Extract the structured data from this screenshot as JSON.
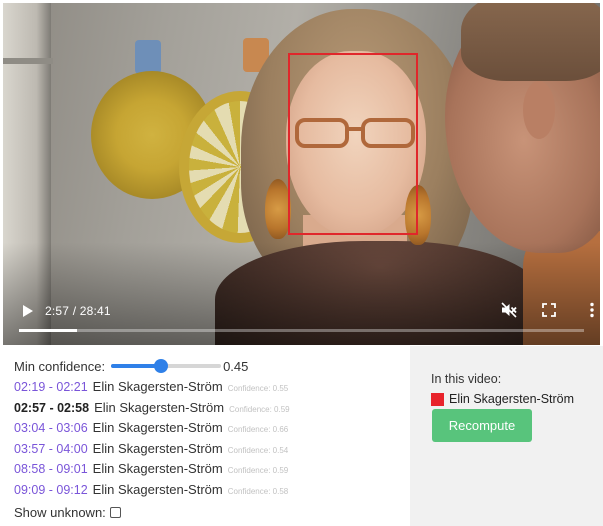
{
  "player": {
    "time_display": "2:57 / 28:41",
    "progress_fraction": 0.103,
    "icons": {
      "play": "play-icon",
      "mute": "volume-muted-icon",
      "fullscreen": "fullscreen-icon",
      "more": "more-vertical-icon"
    }
  },
  "face_box": {
    "color": "#e0272b"
  },
  "confidence": {
    "label": "Min confidence:",
    "value": "0.45",
    "fraction": 0.45
  },
  "occurrences": [
    {
      "time": "02:19 - 02:21",
      "name": "Elin Skagersten-Ström",
      "confidence": "Confidence: 0.55",
      "current": false
    },
    {
      "time": "02:57 - 02:58",
      "name": "Elin Skagersten-Ström",
      "confidence": "Confidence: 0.59",
      "current": true
    },
    {
      "time": "03:04 - 03:06",
      "name": "Elin Skagersten-Ström",
      "confidence": "Confidence: 0.66",
      "current": false
    },
    {
      "time": "03:57 - 04:00",
      "name": "Elin Skagersten-Ström",
      "confidence": "Confidence: 0.54",
      "current": false
    },
    {
      "time": "08:58 - 09:01",
      "name": "Elin Skagersten-Ström",
      "confidence": "Confidence: 0.59",
      "current": false
    },
    {
      "time": "09:09 - 09:12",
      "name": "Elin Skagersten-Ström",
      "confidence": "Confidence: 0.58",
      "current": false
    }
  ],
  "show_unknown": {
    "label": "Show unknown:",
    "checked": false
  },
  "in_video": {
    "title": "In this video:",
    "person": {
      "name": "Elin Skagersten-Ström",
      "color": "#e8232b"
    },
    "button_label": "Recompute",
    "button_color": "#58c47c"
  },
  "colors": {
    "link": "#7a55d9",
    "accent": "#2f80e8",
    "panel_bg": "#f1f1f1"
  }
}
